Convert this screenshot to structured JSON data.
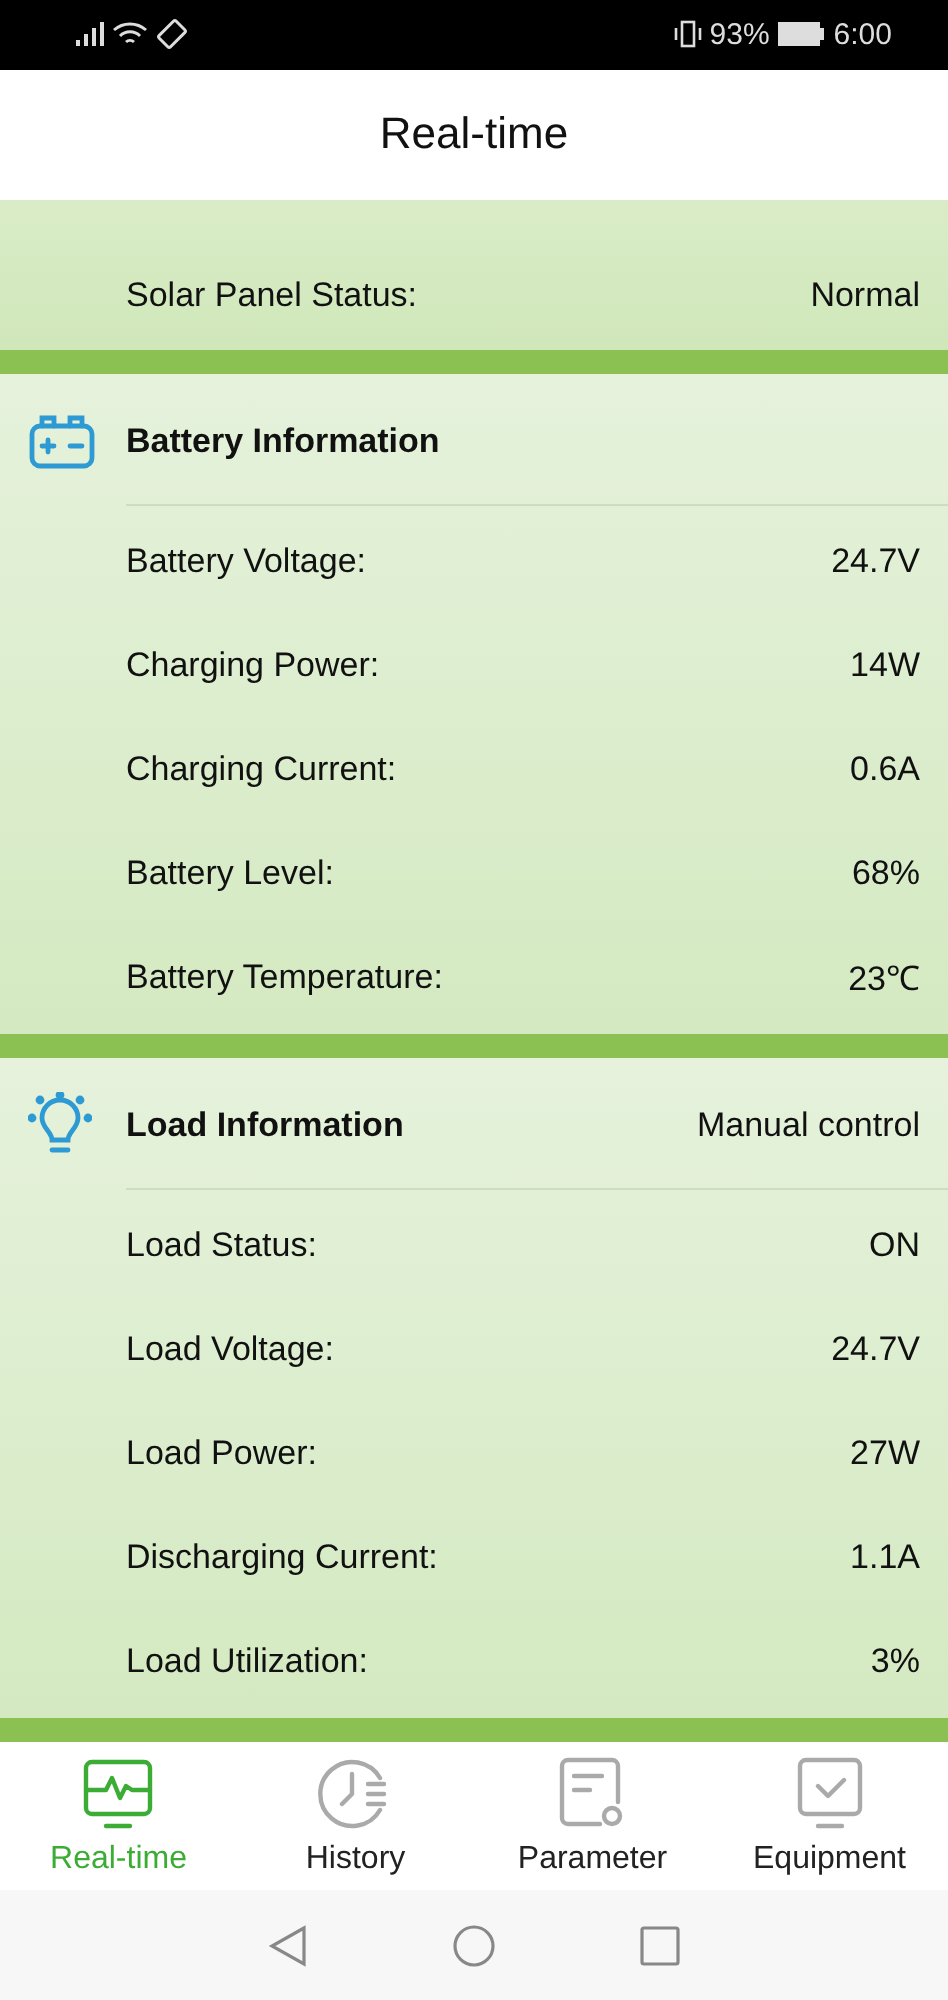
{
  "status_bar": {
    "battery_percent": "93%",
    "time": "6:00"
  },
  "header": {
    "title": "Real-time"
  },
  "solar_rows": [
    {
      "label": "Solar Panel Status:",
      "value": "Normal"
    }
  ],
  "sections": [
    {
      "kind": "battery",
      "title": "Battery Information",
      "rows": [
        {
          "label": "Battery Voltage:",
          "value": "24.7V"
        },
        {
          "label": "Charging Power:",
          "value": "14W"
        },
        {
          "label": "Charging Current:",
          "value": "0.6A"
        },
        {
          "label": "Battery Level:",
          "value": "68%"
        },
        {
          "label": "Battery Temperature:",
          "value": "23℃"
        }
      ]
    },
    {
      "kind": "load",
      "title": "Load Information",
      "mode": "Manual control",
      "rows": [
        {
          "label": "Load Status:",
          "value": "ON"
        },
        {
          "label": "Load Voltage:",
          "value": "24.7V"
        },
        {
          "label": "Load Power:",
          "value": "27W"
        },
        {
          "label": "Discharging Current:",
          "value": "1.1A"
        },
        {
          "label": "Load Utilization:",
          "value": "3%"
        }
      ]
    }
  ],
  "tabs": [
    {
      "kind": "realtime",
      "label": "Real-time",
      "selected": true
    },
    {
      "kind": "history",
      "label": "History",
      "selected": false
    },
    {
      "kind": "parameter",
      "label": "Parameter",
      "selected": false
    },
    {
      "kind": "equipment",
      "label": "Equipment",
      "selected": false
    }
  ]
}
